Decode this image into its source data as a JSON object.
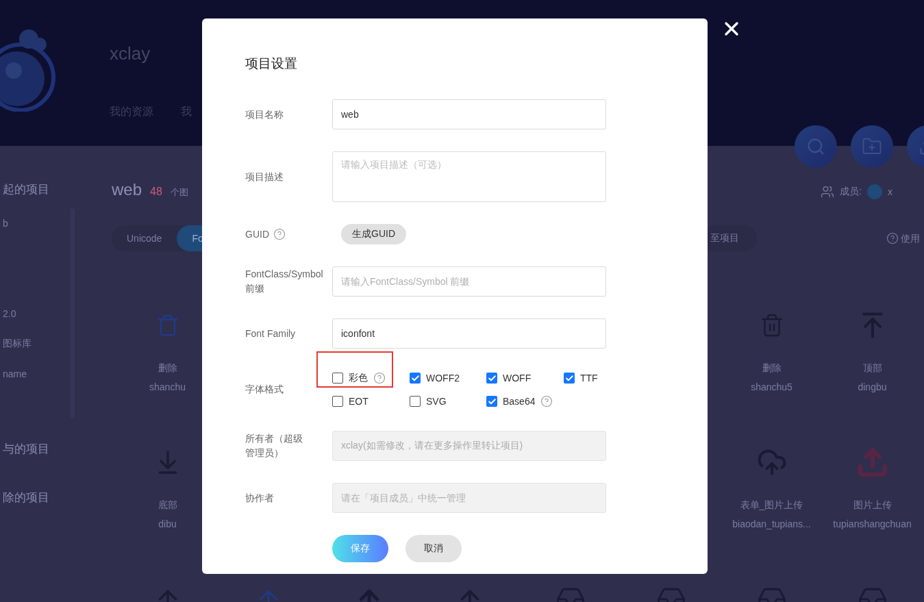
{
  "background": {
    "username": "xclay",
    "nav": [
      "我的资源",
      "我"
    ],
    "sidebar": [
      {
        "kind": "heading",
        "label": "起的项目"
      },
      {
        "kind": "project",
        "label": "b"
      },
      {
        "kind": "project",
        "label": "2.0"
      },
      {
        "kind": "project",
        "label": "图标库"
      },
      {
        "kind": "project",
        "label": "name"
      },
      {
        "kind": "heading",
        "label": "与的项目"
      },
      {
        "kind": "heading",
        "label": "除的项目"
      }
    ],
    "project_name": "web",
    "icon_count": "48",
    "count_unit": "个图",
    "members_label": "成员:",
    "member": "x",
    "mode_tabs": [
      {
        "label": "Unicode",
        "selected": false
      },
      {
        "label": "Fo",
        "selected": true
      }
    ],
    "add_button": "至项目",
    "help_link": "使用",
    "left_icons": [
      {
        "name": "删除",
        "code": "shanchu"
      },
      {
        "name": "底部",
        "code": "dibu"
      }
    ],
    "right_icons": [
      {
        "name": "删除",
        "code": "shanchu5"
      },
      {
        "name": "顶部",
        "code": "dingbu"
      },
      {
        "name": "表单_图片上传",
        "code": "biaodan_tupians..."
      },
      {
        "name": "图片上传",
        "code": "tupianshangchuan"
      }
    ]
  },
  "dialog": {
    "title": "项目设置",
    "fields": [
      {
        "label": "项目名称",
        "kind": "input",
        "value": "web",
        "disabled": false
      },
      {
        "label": "项目描述",
        "kind": "textarea",
        "placeholder": "请输入项目描述（可选）"
      },
      {
        "label": "GUID",
        "help": true,
        "kind": "button",
        "button": "生成GUID"
      },
      {
        "label": "FontClass/Symbol 前缀",
        "kind": "input",
        "placeholder": "请输入FontClass/Symbol 前缀",
        "disabled": false
      },
      {
        "label": "Font Family",
        "kind": "input",
        "value": "iconfont",
        "disabled": false
      },
      {
        "label": "字体格式",
        "kind": "checkboxes",
        "options": [
          {
            "label": "彩色",
            "checked": false,
            "help": true,
            "highlighted": true
          },
          {
            "label": "WOFF2",
            "checked": true,
            "help": false,
            "highlighted": false
          },
          {
            "label": "WOFF",
            "checked": true,
            "help": false,
            "highlighted": false
          },
          {
            "label": "TTF",
            "checked": true,
            "help": false,
            "highlighted": false
          },
          {
            "label": "EOT",
            "checked": false,
            "help": false,
            "highlighted": false
          },
          {
            "label": "SVG",
            "checked": false,
            "help": false,
            "highlighted": false
          },
          {
            "label": "Base64",
            "checked": true,
            "help": true,
            "highlighted": false
          }
        ]
      },
      {
        "label": "所有者（超级管理员）",
        "kind": "input",
        "value": "xclay(如需修改，请在更多操作里转让项目)",
        "disabled": true
      },
      {
        "label": "协作者",
        "kind": "input",
        "placeholder": "请在「项目成员」中统一管理",
        "disabled": true
      }
    ],
    "buttons": [
      {
        "label": "保存",
        "kind": "primary"
      },
      {
        "label": "取消",
        "kind": "secondary"
      }
    ]
  }
}
